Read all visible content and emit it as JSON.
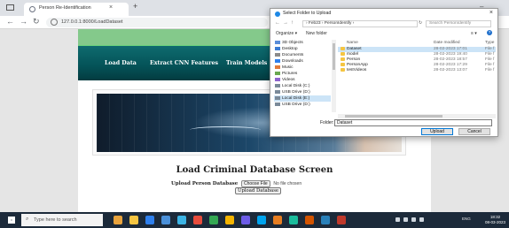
{
  "browser": {
    "tab_title": "Person Re-Identification",
    "tab_close": "×",
    "new_tab": "+",
    "minimize": "–",
    "url": "127.0.0.1:8000/LoadDataset"
  },
  "navbar": {
    "links": [
      "Load Data",
      "Extract CNN Features",
      "Train Models"
    ]
  },
  "page": {
    "title": "Load Criminal Database Screen",
    "upload_label": "Upload Person Database",
    "choose_file_label": "Choose File",
    "no_file_text": "No file chosen",
    "upload_button_label": "Upload Database"
  },
  "dialog": {
    "title": "Select Folder to Upload",
    "close": "×",
    "path": "› Feb23 › PersonIdentify ›",
    "search_placeholder": "Search PersonIdentify",
    "organize_label": "Organize ▾",
    "new_folder_label": "New folder",
    "tree": [
      {
        "label": "3D Objects",
        "color": "#5b8dd9"
      },
      {
        "label": "Desktop",
        "color": "#3a7bd5"
      },
      {
        "label": "Documents",
        "color": "#8a8a8a"
      },
      {
        "label": "Downloads",
        "color": "#2f80ed"
      },
      {
        "label": "Music",
        "color": "#e27b3a"
      },
      {
        "label": "Pictures",
        "color": "#6aa84f"
      },
      {
        "label": "Videos",
        "color": "#8e63ce"
      },
      {
        "label": "Local Disk (C:)",
        "color": "#7a8a99"
      },
      {
        "label": "USB Drive (D:)",
        "color": "#7a8a99"
      },
      {
        "label": "Local Disk (E:)",
        "color": "#7a8a99"
      },
      {
        "label": "USB Drive (D:)",
        "color": "#7a8a99"
      }
    ],
    "tree_selected_index": 9,
    "columns": {
      "name": "Name",
      "date": "Date modified",
      "type": "Type"
    },
    "files": [
      {
        "name": "Dataset",
        "date": "28-02-2023 17:01",
        "type": "File f"
      },
      {
        "name": "model",
        "date": "28-02-2023 19:40",
        "type": "File f"
      },
      {
        "name": "Person",
        "date": "28-02-2023 18:57",
        "type": "File f"
      },
      {
        "name": "PersonApp",
        "date": "28-02-2023 17:29",
        "type": "File f"
      },
      {
        "name": "testVideos",
        "date": "28-02-2023 13:07",
        "type": "File f"
      }
    ],
    "file_selected_index": 0,
    "folder_label": "Folder:",
    "folder_value": "Dataset",
    "upload_button": "Upload",
    "cancel_button": "Cancel"
  },
  "taskbar": {
    "search_placeholder": "Type here to search",
    "app_colors": [
      "#e8a33d",
      "#f5c542",
      "#2f80ed",
      "#4a90d9",
      "#3cb4e5",
      "#e74c3c",
      "#34a853",
      "#f4b400",
      "#6c5ce7",
      "#00a4ef",
      "#e67e22",
      "#1abc9c",
      "#d35400",
      "#2980b9",
      "#c0392b"
    ],
    "tray_lang": "ENG",
    "time": "18:32",
    "date": "08-03-2023"
  }
}
